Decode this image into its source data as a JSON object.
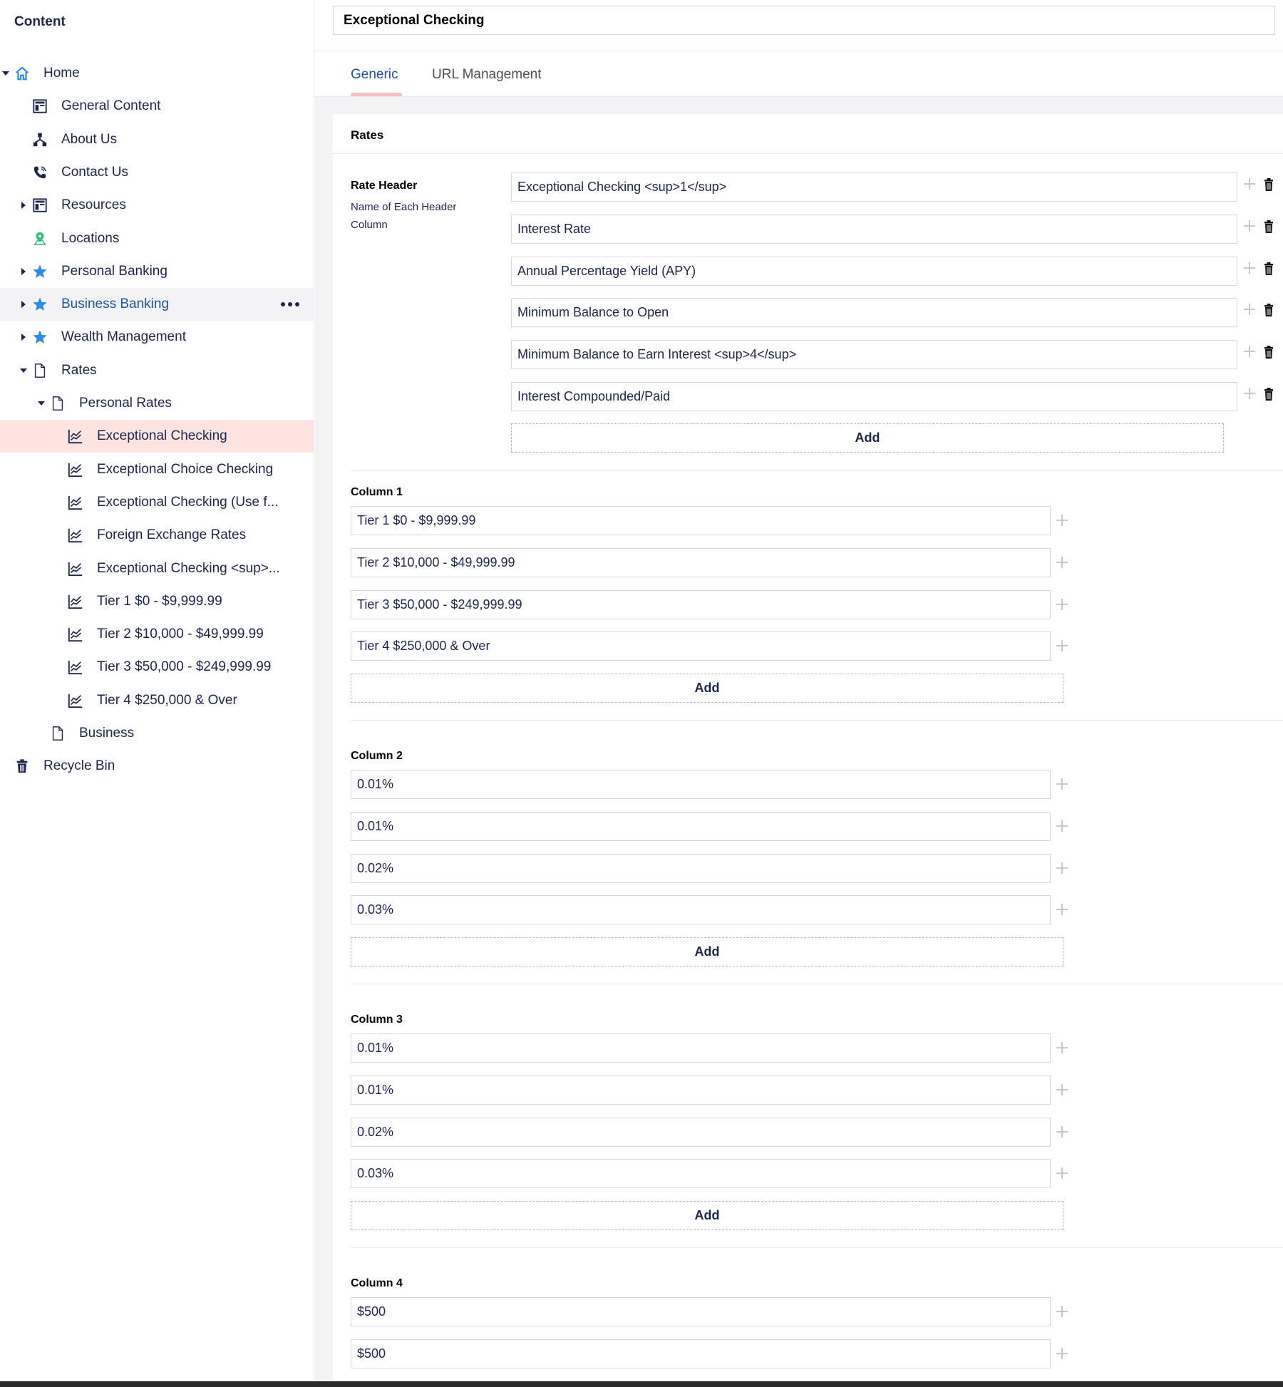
{
  "sidebar": {
    "heading": "Content",
    "items": [
      {
        "label": "Home",
        "icon": "home-icon",
        "caret": "down"
      },
      {
        "label": "General Content",
        "icon": "layout-icon",
        "caret": ""
      },
      {
        "label": "About Us",
        "icon": "sitemap-icon",
        "caret": ""
      },
      {
        "label": "Contact Us",
        "icon": "phone-icon",
        "caret": ""
      },
      {
        "label": "Resources",
        "icon": "layout-icon",
        "caret": "right"
      },
      {
        "label": "Locations",
        "icon": "map-pin-icon",
        "caret": ""
      },
      {
        "label": "Personal Banking",
        "icon": "star-icon",
        "caret": "right"
      },
      {
        "label": "Business Banking",
        "icon": "star-icon",
        "caret": "right"
      },
      {
        "label": "Wealth Management",
        "icon": "star-icon",
        "caret": "right"
      },
      {
        "label": "Rates",
        "icon": "document-icon",
        "caret": "down"
      },
      {
        "label": "Personal Rates",
        "icon": "document-icon",
        "caret": "down"
      },
      {
        "label": "Exceptional Checking",
        "icon": "chart-icon",
        "caret": ""
      },
      {
        "label": "Exceptional Choice Checking",
        "icon": "chart-icon",
        "caret": ""
      },
      {
        "label": "Exceptional Checking (Use f...",
        "icon": "chart-icon",
        "caret": ""
      },
      {
        "label": "Foreign Exchange Rates",
        "icon": "chart-icon",
        "caret": ""
      },
      {
        "label": "Exceptional Checking <sup>...",
        "icon": "chart-icon",
        "caret": ""
      },
      {
        "label": "Tier 1 $0 - $9,999.99",
        "icon": "chart-icon",
        "caret": ""
      },
      {
        "label": "Tier 2 $10,000 - $49,999.99",
        "icon": "chart-icon",
        "caret": ""
      },
      {
        "label": "Tier 3 $50,000 - $249,999.99",
        "icon": "chart-icon",
        "caret": ""
      },
      {
        "label": "Tier 4 $250,000 & Over",
        "icon": "chart-icon",
        "caret": ""
      },
      {
        "label": "Business",
        "icon": "document-icon",
        "caret": ""
      },
      {
        "label": "Recycle Bin",
        "icon": "trash-icon",
        "caret": ""
      }
    ],
    "selected_item": "Exceptional Checking",
    "hovered_item": "Business Banking",
    "more_actions_icon": "more-icon"
  },
  "editor": {
    "name": "Exceptional Checking",
    "tabs": [
      {
        "label": "Generic",
        "active": true
      },
      {
        "label": "URL Management",
        "active": false
      }
    ],
    "group_title": "Rates",
    "rate_header": {
      "label": "Rate Header",
      "description": "Name of Each Header Column",
      "values": [
        "Exceptional Checking <sup>1</sup>",
        "Interest Rate",
        "Annual Percentage Yield (APY)",
        "Minimum Balance to Open",
        "Minimum Balance to Earn Interest <sup>4</sup>",
        "Interest Compounded/Paid"
      ]
    },
    "add_label": "Add",
    "columns": [
      {
        "label": "Column 1",
        "values": [
          "Tier 1 $0 - $9,999.99",
          "Tier 2 $10,000 - $49,999.99",
          "Tier 3 $50,000 - $249,999.99",
          "Tier 4 $250,000 & Over"
        ]
      },
      {
        "label": "Column 2",
        "values": [
          "0.01%",
          "0.01%",
          "0.02%",
          "0.03%"
        ]
      },
      {
        "label": "Column 3",
        "values": [
          "0.01%",
          "0.01%",
          "0.02%",
          "0.03%"
        ]
      },
      {
        "label": "Column 4",
        "values": [
          "$500",
          "$500"
        ]
      }
    ]
  },
  "colors": {
    "text": "#1b264f",
    "link_blue": "#2152a3",
    "icon_blue": "#2e8ae6",
    "icon_green": "#2bc37c",
    "selected_bg": "#fde4e1",
    "tab_underline": "#f5c1bc"
  }
}
